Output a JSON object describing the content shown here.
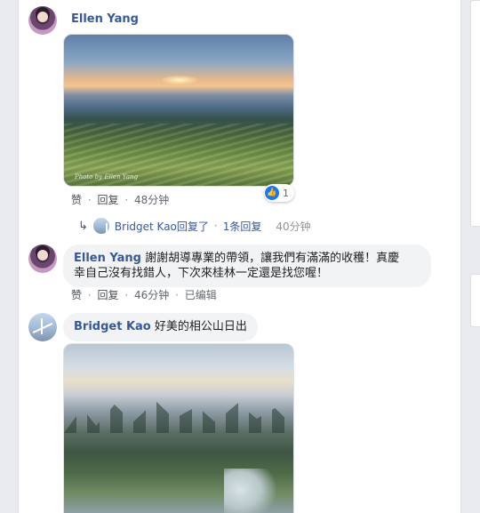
{
  "comments": [
    {
      "author": "Ellen Yang",
      "actions": {
        "like": "赞",
        "reply": "回复",
        "time": "48分钟"
      },
      "reaction_count": "1",
      "replies_summary": {
        "text": "Bridget Kao回复了",
        "count": "1条回复",
        "time": "40分钟"
      }
    },
    {
      "author": "Ellen Yang",
      "text_line1": "謝謝胡導專業的帶領，讓我們有滿滿的收穫！真慶",
      "text_line2": "幸自己沒有找錯人，下次來桂林一定還是找您喔！",
      "actions": {
        "like": "赞",
        "reply": "回复",
        "time": "46分钟",
        "edited": "已编辑"
      }
    },
    {
      "author": "Bridget Kao",
      "text": "好美的相公山日出"
    }
  ],
  "photo_watermark": "Photo by Ellen Yang"
}
